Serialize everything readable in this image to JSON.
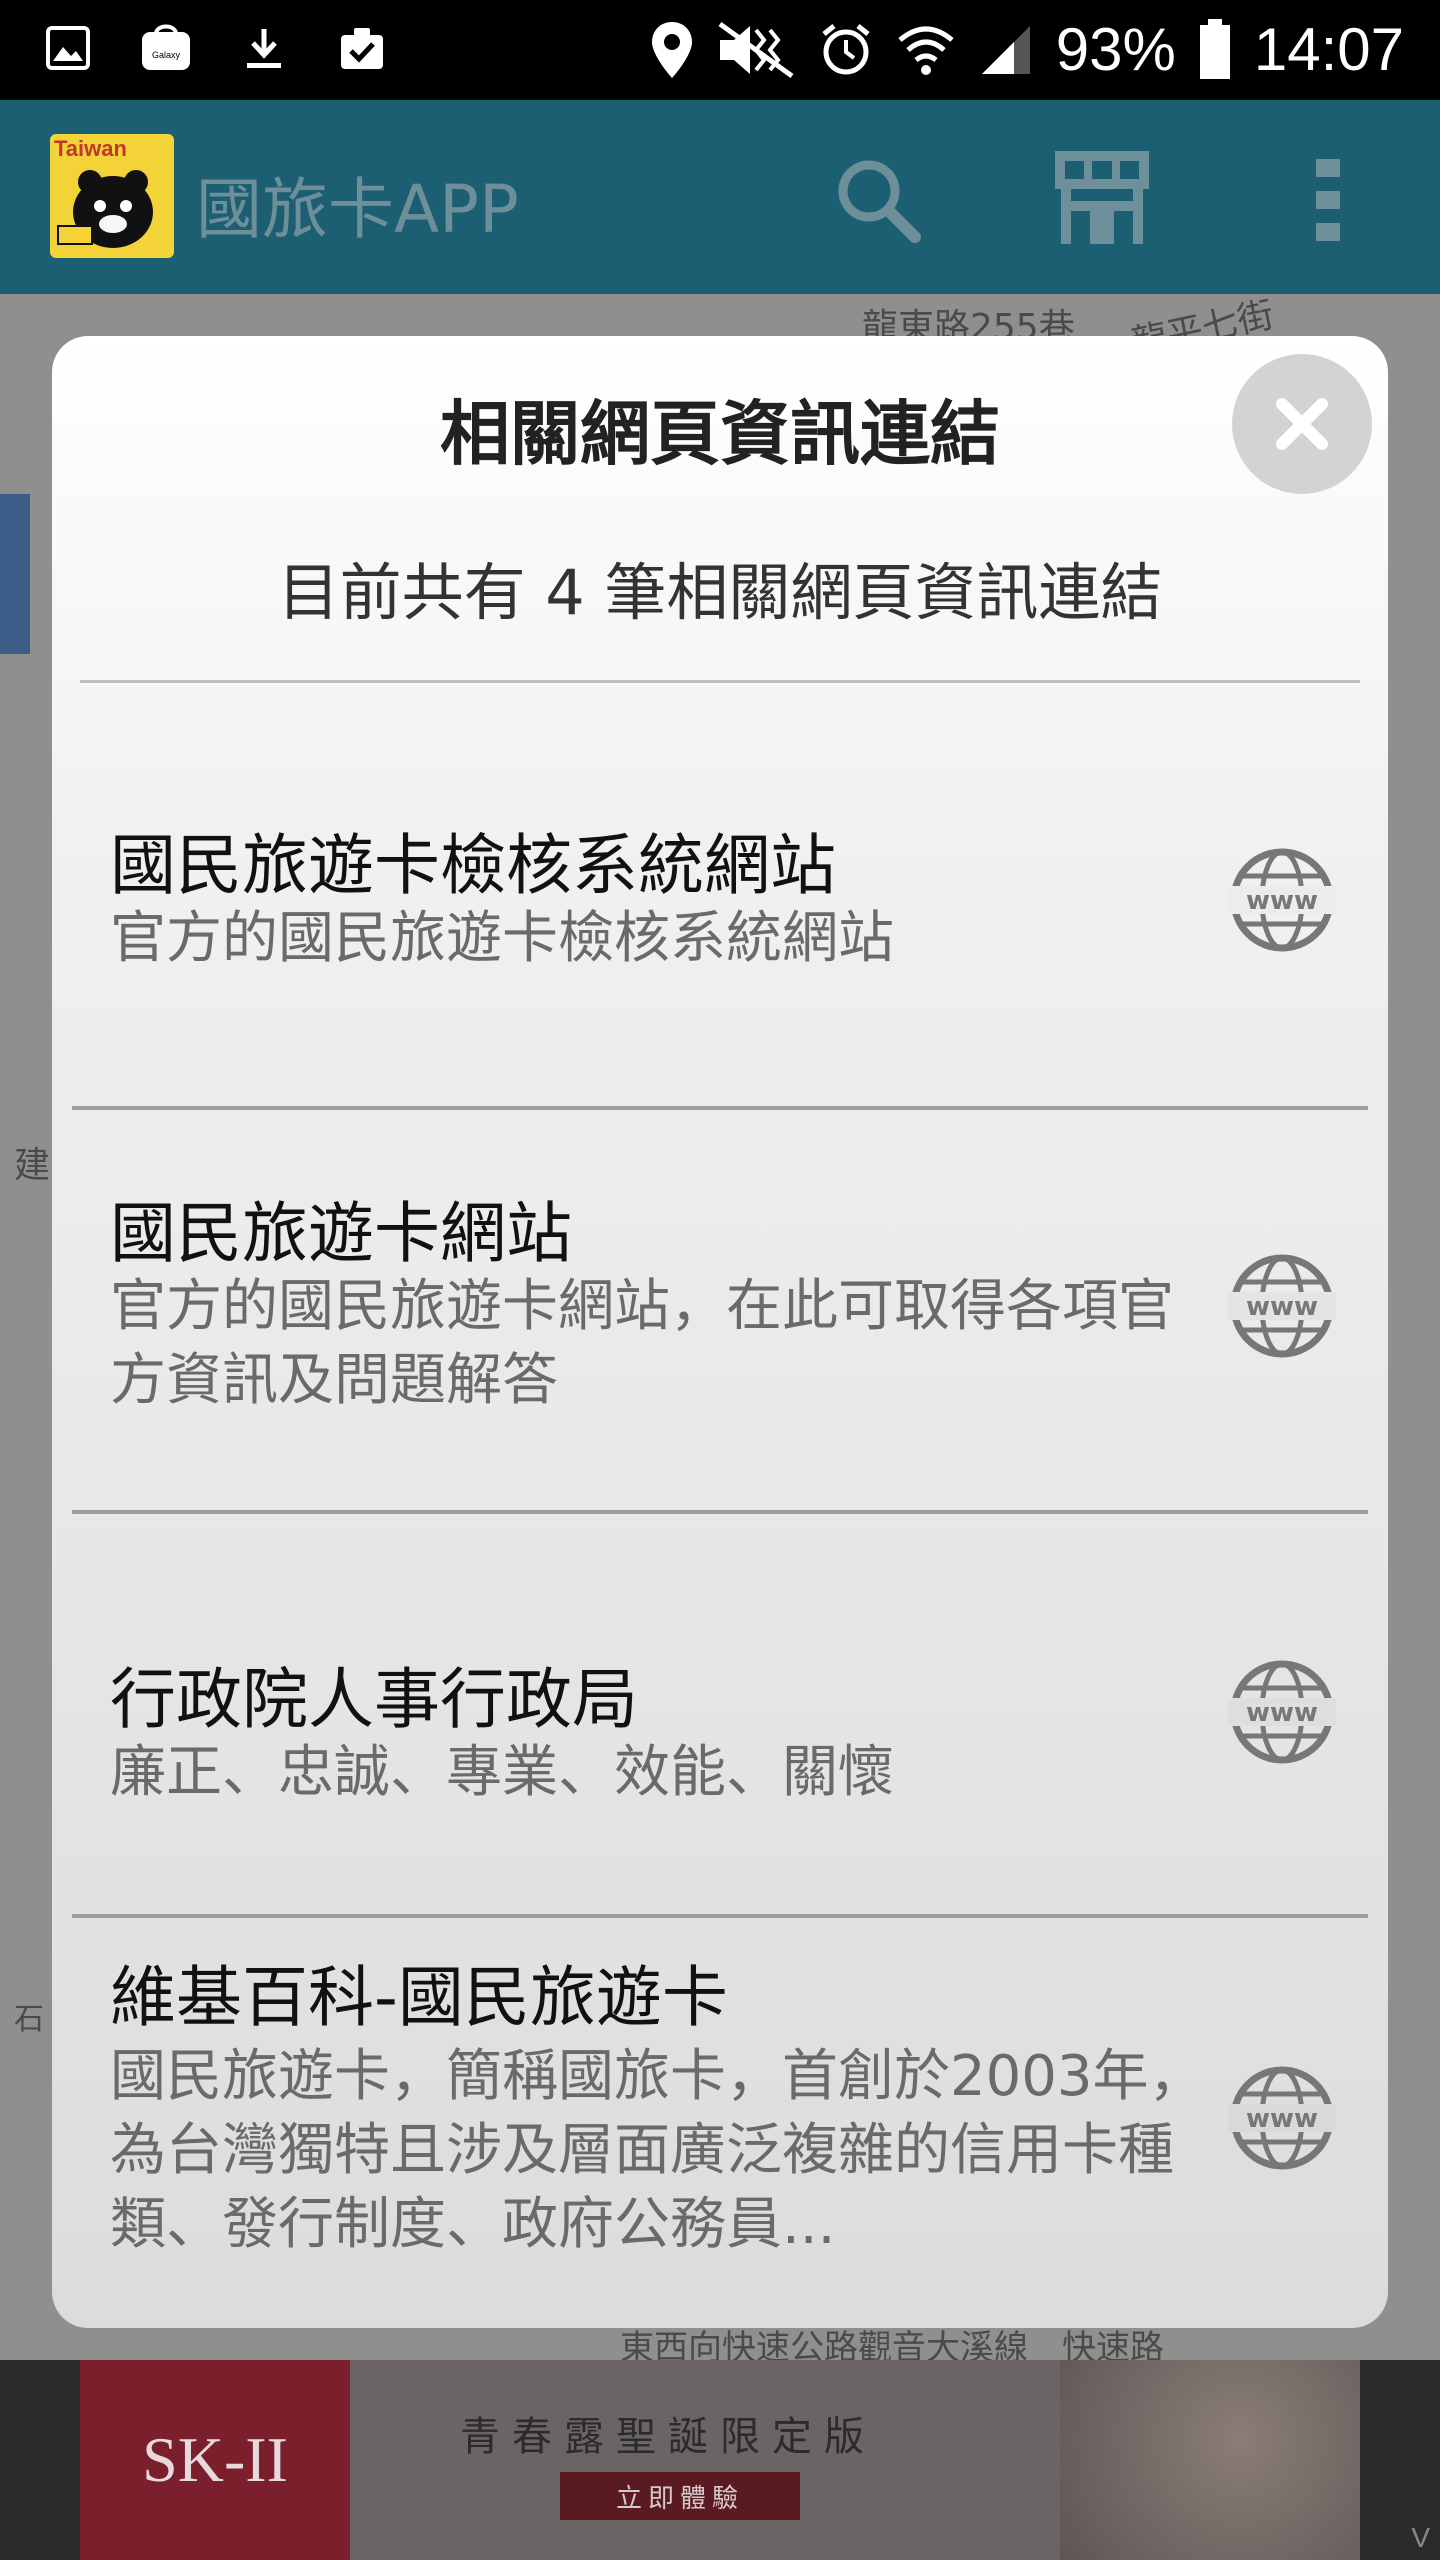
{
  "status_bar": {
    "left_icons": [
      "gallery-icon",
      "galaxy-store-icon",
      "download-icon",
      "clipboard-check-icon"
    ],
    "galaxy_label": "Galaxy",
    "battery_text": "93%",
    "time": "14:07",
    "right_icons": [
      "location-icon",
      "mute-icon",
      "alarm-icon",
      "wifi-icon",
      "signal-icon",
      "battery-icon"
    ]
  },
  "app_bar": {
    "logo_text": "Taiwan",
    "title": "國旅卡APP",
    "actions": [
      "search-icon",
      "store-icon",
      "overflow-menu-icon"
    ]
  },
  "map": {
    "labels": [
      "龍東路255巷",
      "龍平七街",
      "建",
      "石"
    ]
  },
  "dialog": {
    "title": "相關網頁資訊連結",
    "count_text": "目前共有 4 筆相關網頁資訊連結",
    "items": [
      {
        "title": "國民旅遊卡檢核系統網站",
        "desc": "官方的國民旅遊卡檢核系統網站",
        "icon": "www-globe-icon"
      },
      {
        "title": "國民旅遊卡網站",
        "desc": "官方的國民旅遊卡網站，在此可取得各項官方資訊及問題解答",
        "icon": "www-globe-icon"
      },
      {
        "title": "行政院人事行政局",
        "desc": "廉正、忠誠、專業、效能、關懷",
        "icon": "www-globe-icon"
      },
      {
        "title": "維基百科-國民旅遊卡",
        "desc": "國民旅遊卡，簡稱國旅卡，首創於2003年，為台灣獨特且涉及層面廣泛複雜的信用卡種類、發行制度、政府公務員...",
        "icon": "www-globe-icon"
      }
    ]
  },
  "map_bottom_label": "東西向快速公路觀音大溪線　快速路",
  "ad": {
    "brand": "SK-II",
    "headline": "青春露聖誕限定版",
    "cta": "立即體驗",
    "corner": "V"
  },
  "colors": {
    "app_bar": "#1d5f72",
    "dialog_bg": "#f1f1f1",
    "close_button": "#d3d3d3",
    "divider": "#bdbdbd"
  }
}
